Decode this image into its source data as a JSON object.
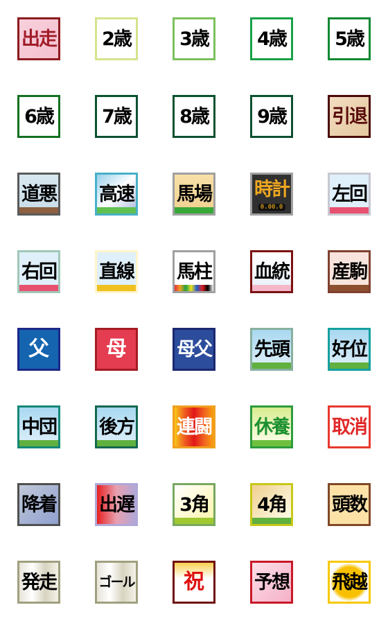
{
  "tiles": [
    {
      "label": "出走",
      "color": "#a01c28",
      "bg": "linear-gradient(135deg,#f8d0dc,#f4c0d0)",
      "border": "#8c1a1e",
      "icon": "horseshoe-icon"
    },
    {
      "label": "2歳",
      "color": "#000",
      "bg": "#fff",
      "border": "#d4e48c"
    },
    {
      "label": "3歳",
      "color": "#000",
      "bg": "#fff",
      "border": "#7cc05c"
    },
    {
      "label": "4歳",
      "color": "#000",
      "bg": "#fff",
      "border": "#18a048"
    },
    {
      "label": "5歳",
      "color": "#000",
      "bg": "#fff",
      "border": "#108834"
    },
    {
      "label": "6歳",
      "color": "#000",
      "bg": "#fff",
      "border": "#147020"
    },
    {
      "label": "7歳",
      "color": "#000",
      "bg": "#fff",
      "border": "#0c5030"
    },
    {
      "label": "8歳",
      "color": "#000",
      "bg": "#fff",
      "border": "#0c5030"
    },
    {
      "label": "9歳",
      "color": "#000",
      "bg": "#fff",
      "border": "#0c5030"
    },
    {
      "label": "引退",
      "color": "#5a0c0c",
      "bg": "linear-gradient(135deg,#f2dcc0,#e4c8a0)",
      "border": "#4a0808",
      "icon": "horseshoe-icon"
    },
    {
      "label": "道悪",
      "color": "#000",
      "bg": "linear-gradient(#d8e8f0,#c8dce8)",
      "border": "#5a5a5a",
      "ground": "#8c6040",
      "icon": "muddy-track-icon"
    },
    {
      "label": "高速",
      "color": "#000",
      "bg": "linear-gradient(135deg,#9ad0ec,#fff,#a8b8dc)",
      "border": "#48b0c8",
      "ground": "#60c050",
      "icon": "arrow-icon"
    },
    {
      "label": "馬場",
      "color": "#000",
      "bg": "linear-gradient(#f8e0a8,#f0d090)",
      "border": "#a0a0a0",
      "ground": "#38a838",
      "icon": "turf-icon"
    },
    {
      "label": "時計",
      "color": "#f0a820",
      "bg": "#303030",
      "border": "#a0a0a0",
      "sub": "0.00.0",
      "icon": "clock-display-icon"
    },
    {
      "label": "左回",
      "color": "#000",
      "bg": "#e0f0fa",
      "border": "#c8c8d0",
      "ground": "#e85070",
      "icon": "left-turn-arrow-icon"
    },
    {
      "label": "右回",
      "color": "#000",
      "bg": "#e0f0fa",
      "border": "#a0c8b8",
      "ground": "#e85070",
      "icon": "right-turn-arrow-icon"
    },
    {
      "label": "直線",
      "color": "#000",
      "bg": "#e0f0fa",
      "border": "#fff4c8",
      "ground": "#f0c020",
      "icon": "straight-arrow-icon"
    },
    {
      "label": "馬柱",
      "color": "#000",
      "bg": "#fff",
      "border": "#a0a0a0",
      "ground": "linear-gradient(90deg,#e03040,#f0a020,#20a040,#f0e020,#2060d0,#e02020,#000,#fff)",
      "icon": "race-card-icon"
    },
    {
      "label": "血統",
      "color": "#000",
      "bg": "linear-gradient(#fff,#e8f0f8)",
      "border": "#7a1010",
      "ground": "#f4b8c8",
      "icon": "pedigree-chart-icon"
    },
    {
      "label": "産駒",
      "color": "#000",
      "bg": "#f8e4dc",
      "border": "#804030",
      "ground": "#8c5030",
      "icon": "mare-foal-icon"
    },
    {
      "label": "父",
      "color": "#fff",
      "bg": "#1464b0",
      "border": "#1c2888"
    },
    {
      "label": "母",
      "color": "#fff",
      "bg": "#e43c50",
      "border": "#a41c24"
    },
    {
      "label": "母父",
      "color": "#fff",
      "bg": "#2c4c9c",
      "border": "#1c2870"
    },
    {
      "label": "先頭",
      "color": "#000",
      "bg": "linear-gradient(#a8d8f0,#e0f0fa)",
      "border": "#88b0a0",
      "ground": "#60b040",
      "icon": "position-marker-icon"
    },
    {
      "label": "好位",
      "color": "#000",
      "bg": "linear-gradient(#a8d8f0,#e0f0fa)",
      "border": "#14a0a0",
      "ground": "#60b040",
      "icon": "position-marker-icon"
    },
    {
      "label": "中団",
      "color": "#000",
      "bg": "linear-gradient(#a8d8f0,#e0f0fa)",
      "border": "#148878",
      "ground": "#60b040",
      "icon": "position-marker-icon"
    },
    {
      "label": "後方",
      "color": "#000",
      "bg": "linear-gradient(#a8d8f0,#e0f0fa)",
      "border": "#146850",
      "ground": "#60b040",
      "icon": "position-marker-icon"
    },
    {
      "label": "連闘",
      "color": "#fff",
      "bg": "linear-gradient(90deg,#f8c818,#f06020,#e01818,#f06020,#f8a010)",
      "border": "#f0a020",
      "icon": "fire-icon"
    },
    {
      "label": "休養",
      "color": "#1c9030",
      "bg": "linear-gradient(#d8ec90,#fffff0)",
      "border": "#2c9c3c",
      "ground": "#70c040",
      "icon": "resting-horse-icon"
    },
    {
      "label": "取消",
      "color": "#e02828",
      "bg": "#fff",
      "border": "#e83830",
      "icon": "scratched-horse-icon"
    },
    {
      "label": "降着",
      "color": "#000",
      "bg": "linear-gradient(135deg,#c0c8d8,#90a0d0)",
      "border": "#505050",
      "icon": "gate-icon"
    },
    {
      "label": "出遅",
      "color": "#000",
      "bg": "linear-gradient(90deg,#e82020,#e8a0b0,#b0a8d8)",
      "border": "#b0a8d8",
      "icon": "horse-head-icon"
    },
    {
      "label": "3角",
      "color": "#000",
      "bg": "linear-gradient(135deg,#fff,#fff4a8)",
      "border": "#78a860",
      "ground": "#a0c830",
      "icon": "corner-icon"
    },
    {
      "label": "4角",
      "color": "#000",
      "bg": "linear-gradient(135deg,#f0d090,#fffff0)",
      "border": "#c8c818",
      "ground": "#60b040",
      "icon": "corner-icon"
    },
    {
      "label": "頭数",
      "color": "#000",
      "bg": "#fde2a8",
      "border": "#804828",
      "icon": "horse-silhouette-icon"
    },
    {
      "label": "発走",
      "color": "#000",
      "bg": "linear-gradient(90deg,#e8e4d8,#fff,#d8d4c0,#f4f2e8)",
      "border": "#a0a080",
      "icon": "start-flag-icon"
    },
    {
      "label": "ゴール",
      "color": "#000",
      "bg": "linear-gradient(90deg,#e8e4d8,#fff,#d8d4c0,#f4f2e8)",
      "border": "#a0a080",
      "icon": "checkered-flag-icon"
    },
    {
      "label": "祝",
      "color": "#e01010",
      "bg": "linear-gradient(#f8d050,#fff 40%)",
      "border": "#701010",
      "icon": "kusudama-icon"
    },
    {
      "label": "予想",
      "color": "#000",
      "bg": "linear-gradient(135deg,#fde0e8,#f4b0c8)",
      "border": "#c81828",
      "icon": "pen-icon"
    },
    {
      "label": "飛越",
      "color": "#000",
      "bg": "radial-gradient(circle,#f8c000 55%,#fff 70%)",
      "border": "#f8c800",
      "icon": "jumping-horse-icon"
    }
  ]
}
